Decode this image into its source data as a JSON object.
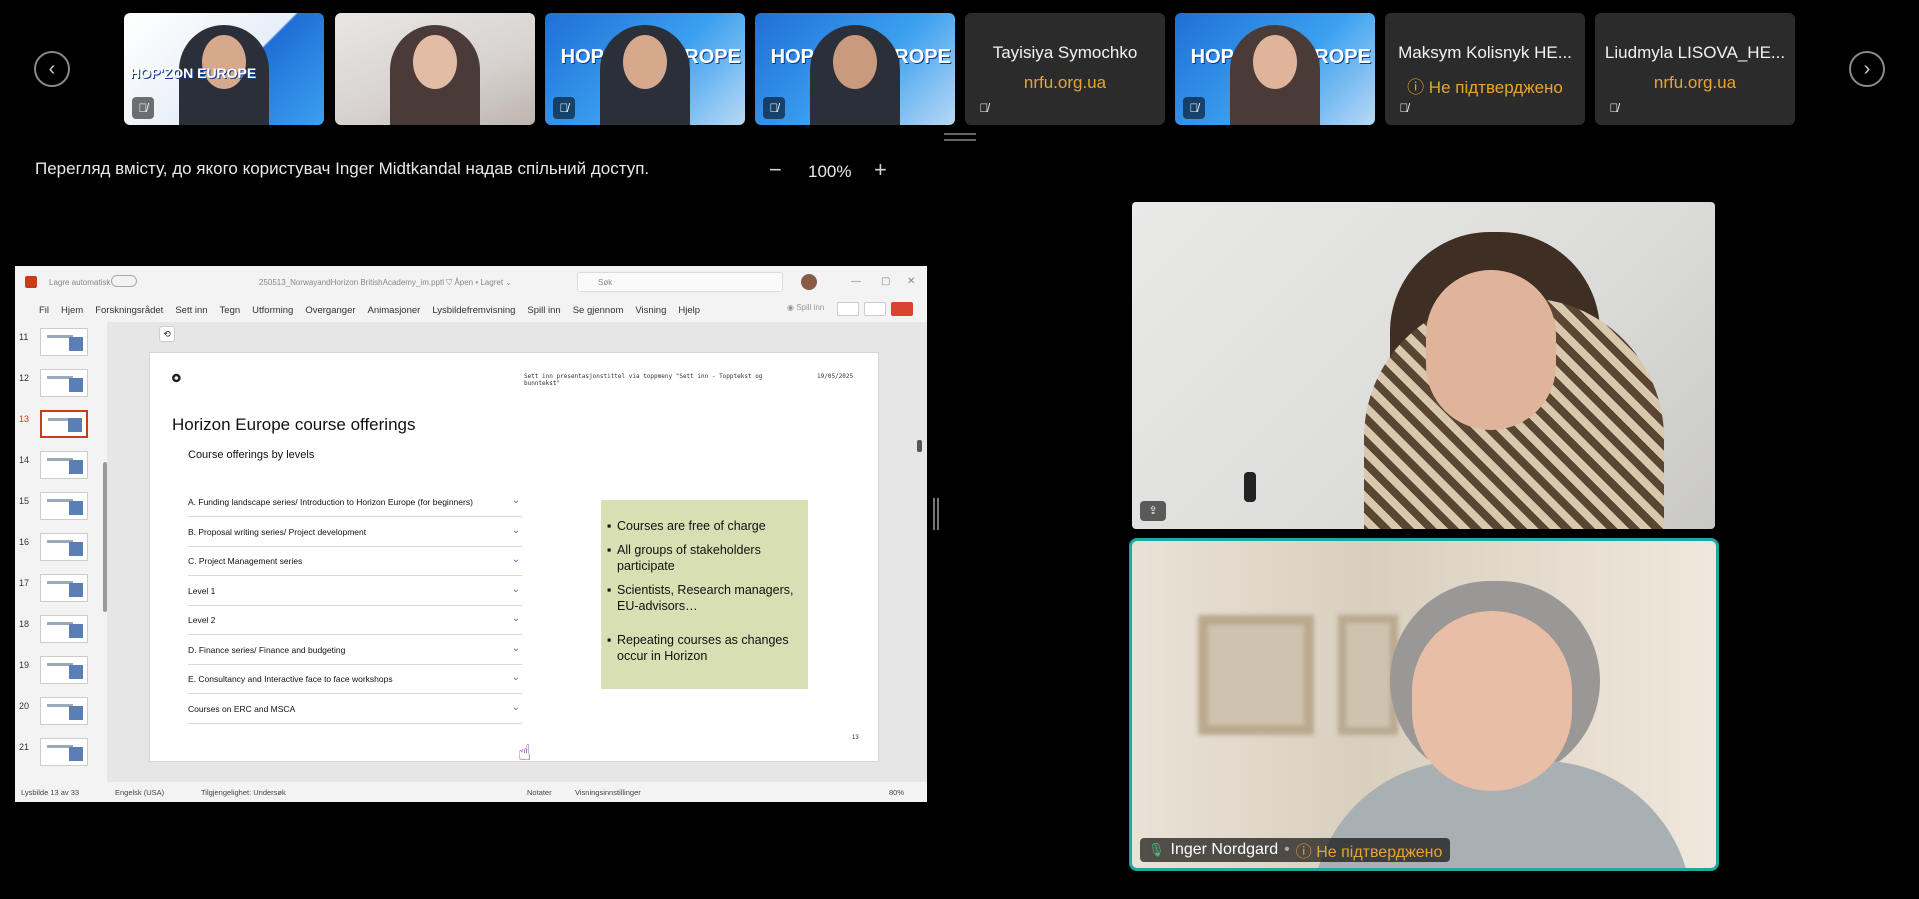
{
  "carousel": {
    "prev_icon": "chevron-left-icon",
    "next_icon": "chevron-right-icon"
  },
  "participants": [
    {
      "type": "video",
      "banner": "HOP'ZON EUROPE"
    },
    {
      "type": "video"
    },
    {
      "type": "video",
      "banner": "HOP'ZON EUROPE"
    },
    {
      "type": "video",
      "banner": "HOP'ZON EUROPE"
    },
    {
      "type": "name",
      "name": "Tayisiya Symochko",
      "subtitle": "nrfu.org.ua"
    },
    {
      "type": "video",
      "banner": "HOP'ZON EUROPE"
    },
    {
      "type": "name",
      "name": "Maksym Kolisnyk HE...",
      "subtitle": "ⓘ Не підтверджено"
    },
    {
      "type": "name",
      "name": "Liudmyla LISOVA_HE...",
      "subtitle": "nrfu.org.ua"
    }
  ],
  "share": {
    "caption": "Перегляд вмісту, до якого користувач Inger Midtkandal надав спільний доступ.",
    "zoom_minus": "−",
    "zoom_value": "100%",
    "zoom_plus": "+"
  },
  "ppt": {
    "autosave": "Lagre automatisk",
    "docname": "250513_NorwayandHorizon BritishAcademy_im.pptl   ⛉ Åpen • Lagret ⌄",
    "search_placeholder": "Søk",
    "menu": [
      "Fil",
      "Hjem",
      "Forskningsrådet",
      "Sett inn",
      "Tegn",
      "Utforming",
      "Overganger",
      "Animasjoner",
      "Lysbildefremvisning",
      "Spill inn",
      "Se gjennom",
      "Visning",
      "Hjelp"
    ],
    "record_label": "◉ Spill inn",
    "thumbnails": [
      "11",
      "12",
      "13",
      "14",
      "15",
      "16",
      "17",
      "18",
      "19",
      "20",
      "21"
    ],
    "active_thumbnail": "13",
    "slide": {
      "logo": "🞉",
      "header_text": "Sett inn presentasjonstittel via toppmeny \"Sett inn - Topptekst og bunntekst\"",
      "date": "19/05/2025",
      "title": "Horizon Europe course offerings",
      "subtitle": "Course offerings by levels",
      "accordion": [
        "A. Funding landscape series/ Introduction to Horizon Europe (for beginners)",
        "B. Proposal writing series/ Project development",
        "C. Project Management series",
        "Level 1",
        "Level 2",
        "D. Finance series/ Finance and budgeting",
        "E. Consultancy and Interactive face to face workshops",
        "Courses on ERC and MSCA"
      ],
      "box_bullets": [
        "Courses are free of charge",
        "All groups of stakeholders participate",
        "Scientists, Research managers, EU-advisors…",
        "Repeating courses as changes occur in Horizon"
      ],
      "page_number": "13"
    },
    "status": {
      "slide_counter": "Lysbilde 13 av 33",
      "language": "Engelsk (USA)",
      "accessibility": "Tilgjengelighet: Undersøk",
      "notes": "Notater",
      "view_settings": "Visningsinnstillinger",
      "zoom": "80%"
    }
  },
  "speaker": {
    "name": "Inger Nordgard",
    "status": "ⓘ Не підтверджено"
  }
}
